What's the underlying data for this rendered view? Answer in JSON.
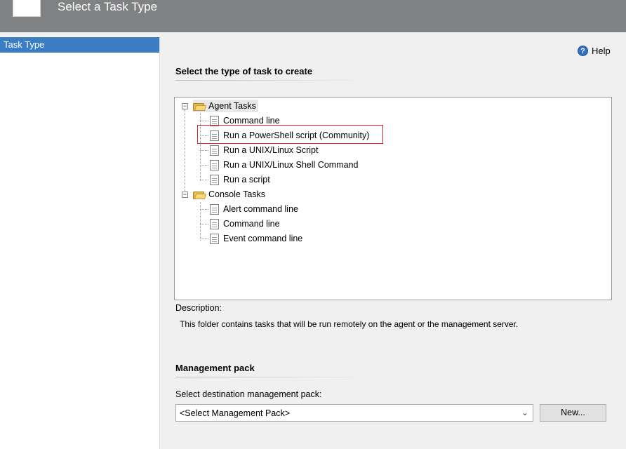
{
  "header": {
    "title": "Select a Task Type"
  },
  "sidebar": {
    "items": [
      {
        "label": "Task Type"
      }
    ]
  },
  "help": {
    "label": "Help"
  },
  "main": {
    "section_title": "Select the type of task to create",
    "tree": {
      "groups": [
        {
          "label": "Agent Tasks",
          "items": [
            "Command line",
            "Run a PowerShell script (Community)",
            "Run a UNIX/Linux Script",
            "Run a UNIX/Linux Shell Command",
            "Run a script"
          ]
        },
        {
          "label": "Console Tasks",
          "items": [
            "Alert command line",
            "Command line",
            "Event command line"
          ]
        }
      ],
      "highlighted_item": "Run a PowerShell script (Community)"
    },
    "description_label": "Description:",
    "description_text": "This folder contains tasks that will be run remotely on the agent or the management server."
  },
  "management_pack": {
    "section_title": "Management pack",
    "select_label": "Select destination management pack:",
    "select_value": "<Select Management Pack>",
    "new_button": "New..."
  },
  "colors": {
    "header": "#7f8183",
    "selection": "#3b7dc4",
    "highlight_border": "#d9232d"
  }
}
